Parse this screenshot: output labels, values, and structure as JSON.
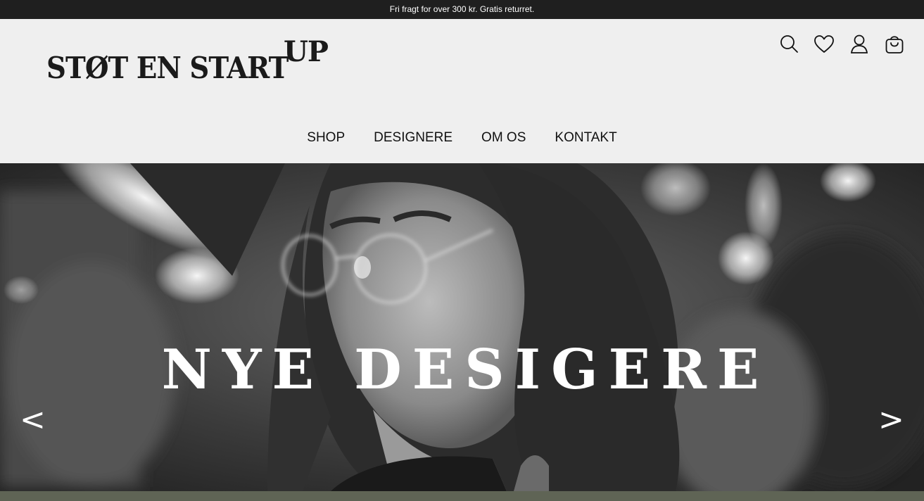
{
  "announcement": "Fri fragt for over 300 kr. Gratis returret.",
  "logo": {
    "main": "STØT EN START",
    "sup": "UP"
  },
  "header_icons": [
    "search-icon",
    "heart-icon",
    "user-icon",
    "shopping-bag-icon"
  ],
  "nav": {
    "items": [
      {
        "label": "SHOP"
      },
      {
        "label": "DESIGNERE"
      },
      {
        "label": "OM OS"
      },
      {
        "label": "KONTAKT"
      }
    ]
  },
  "hero": {
    "title": "NYE DESIGERE",
    "prev": "<",
    "next": ">"
  },
  "colors": {
    "topbar": "#1f1f1f",
    "header_bg": "#efefef",
    "text": "#111111",
    "bottom_strip": "#5f6455"
  }
}
